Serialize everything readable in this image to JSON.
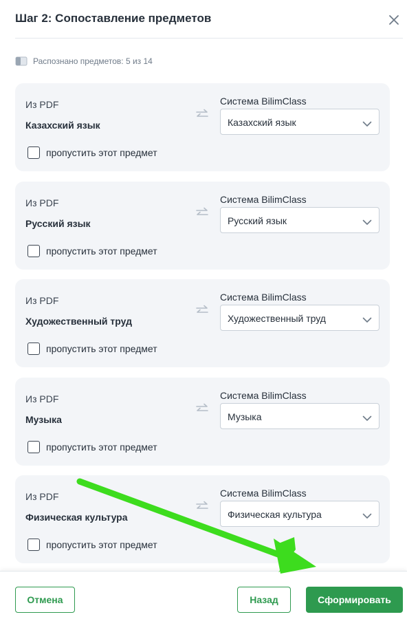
{
  "dialog": {
    "title": "Шаг 2: Сопоставление предметов",
    "recognized_text": "Распознано предметов: 5 из 14"
  },
  "labels": {
    "from_pdf": "Из PDF",
    "system": "Система BilimClass",
    "skip": "пропустить этот предмет"
  },
  "subjects": [
    {
      "pdf_name": "Казахский язык",
      "selected": "Казахский язык",
      "skipped": false
    },
    {
      "pdf_name": "Русский язык",
      "selected": "Русский язык",
      "skipped": false
    },
    {
      "pdf_name": "Художественный труд",
      "selected": "Художественный труд",
      "skipped": false
    },
    {
      "pdf_name": "Музыка",
      "selected": "Музыка",
      "skipped": false
    },
    {
      "pdf_name": "Физическая культура",
      "selected": "Физическая культура",
      "skipped": false
    }
  ],
  "footer": {
    "cancel_label": "Отмена",
    "back_label": "Назад",
    "submit_label": "Сформировать"
  },
  "colors": {
    "accent": "#2e9a4f",
    "card_bg": "#f3f5f8",
    "annotation_arrow": "#3ddc1e"
  },
  "icons": {
    "close": "close-icon",
    "recognized": "book-icon",
    "swap": "swap-arrows-icon",
    "dropdown": "chevron-down-icon",
    "annotation": "green-arrow-annotation"
  }
}
